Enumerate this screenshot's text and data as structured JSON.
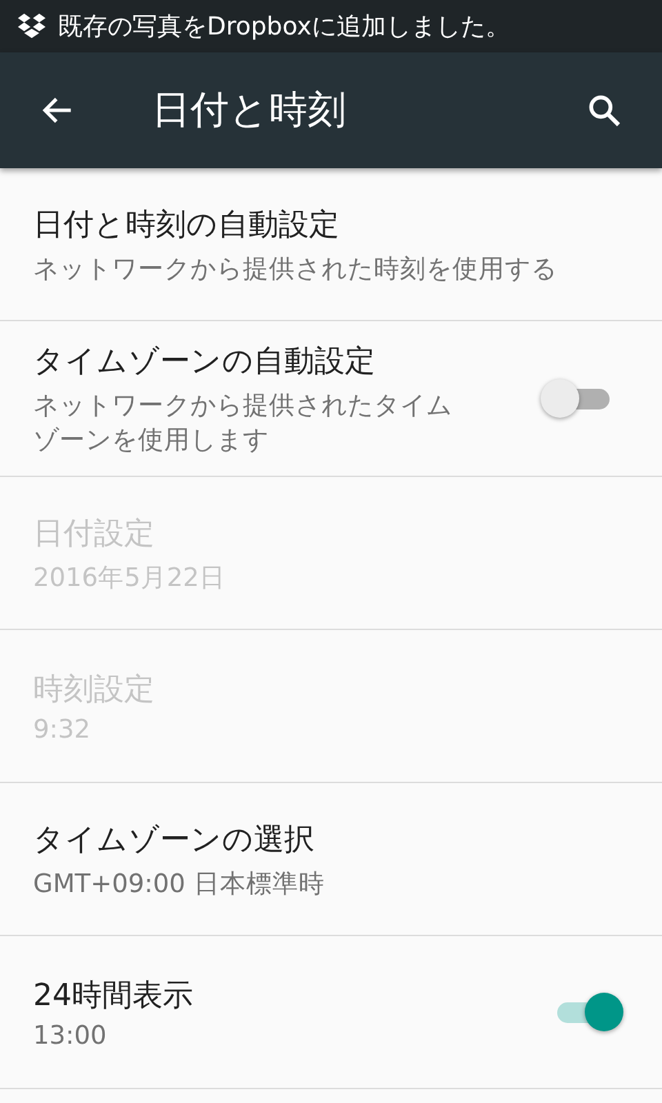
{
  "status_bar": {
    "notification": "既存の写真をDropboxに追加しました。"
  },
  "toolbar": {
    "title": "日付と時刻"
  },
  "settings": [
    {
      "kind": "plain",
      "title": "日付と時刻の自動設定",
      "summary": "ネットワークから提供された時刻を使用する",
      "disabled": false
    },
    {
      "kind": "switch",
      "title": "タイムゾーンの自動設定",
      "summary": "ネットワークから提供されたタイムゾーンを使用します",
      "disabled": false,
      "on": false
    },
    {
      "kind": "plain",
      "title": "日付設定",
      "summary": "2016年5月22日",
      "disabled": true
    },
    {
      "kind": "plain",
      "title": "時刻設定",
      "summary": "9:32",
      "disabled": true
    },
    {
      "kind": "plain",
      "title": "タイムゾーンの選択",
      "summary": "GMT+09:00 日本標準時",
      "disabled": false
    },
    {
      "kind": "switch",
      "title": "24時間表示",
      "summary": "13:00",
      "disabled": false,
      "on": true
    }
  ]
}
